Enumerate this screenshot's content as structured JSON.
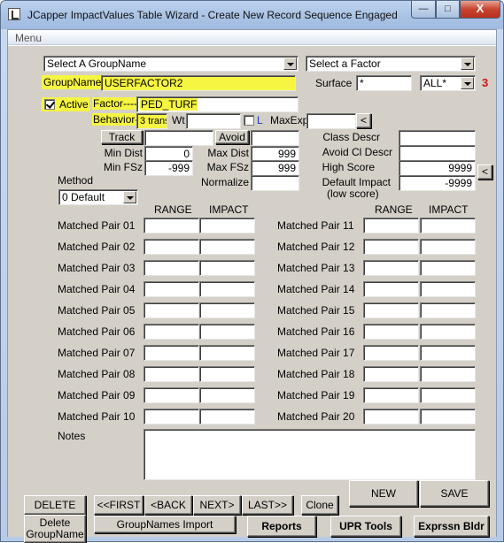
{
  "window": {
    "title": "JCapper ImpactValues Table Wizard -  Create New Record Sequence Engaged",
    "min_label": "—",
    "max_label": "□",
    "close_label": "X"
  },
  "menu": {
    "label": "Menu"
  },
  "group_select": {
    "value": "Select A GroupName"
  },
  "factor_select": {
    "value": "Select a Factor"
  },
  "groupname": {
    "label": "GroupName",
    "value": "USERFACTOR2"
  },
  "surface": {
    "label": "Surface",
    "value": "*",
    "all_value": "ALL*",
    "count": "3"
  },
  "active": {
    "label": "Active",
    "checked": true
  },
  "factor": {
    "label": "Factor-----",
    "value": "PED_TURF"
  },
  "behavior": {
    "label": "Behavior----",
    "value": "3 trans",
    "wt_label": "Wt",
    "wt_value": "",
    "l_label": "L",
    "maxexp_label": "MaxExp",
    "maxexp_value": "",
    "lt_button": "<"
  },
  "track": {
    "button": "Track",
    "value": ""
  },
  "avoid": {
    "button": "Avoid",
    "value": ""
  },
  "min_dist": {
    "label": "Min Dist",
    "value": "0"
  },
  "min_fsz": {
    "label": "Min FSz",
    "value": "-999"
  },
  "max_dist": {
    "label": "Max Dist",
    "value": "999"
  },
  "max_fsz": {
    "label": "Max FSz",
    "value": "999"
  },
  "normalize": {
    "label": "Normalize",
    "value": ""
  },
  "class_descr": {
    "label": "Class Descr",
    "value": ""
  },
  "avoid_cl_descr": {
    "label": "Avoid Cl Descr",
    "value": ""
  },
  "high_score": {
    "label": "High Score",
    "value": "9999"
  },
  "default_impact": {
    "label": "Default Impact",
    "sublabel": "(low score)",
    "value": "-9999",
    "side_button": "<"
  },
  "method": {
    "label": "Method",
    "value": "0 Default"
  },
  "matched_pairs": {
    "range_header": "RANGE",
    "impact_header": "IMPACT",
    "left": [
      "Matched Pair 01",
      "Matched Pair 02",
      "Matched Pair 03",
      "Matched Pair 04",
      "Matched Pair 05",
      "Matched Pair 06",
      "Matched Pair 07",
      "Matched Pair 08",
      "Matched Pair 09",
      "Matched Pair 10"
    ],
    "right": [
      "Matched Pair 11",
      "Matched Pair 12",
      "Matched Pair 13",
      "Matched Pair 14",
      "Matched Pair 15",
      "Matched Pair 16",
      "Matched Pair 17",
      "Matched Pair 18",
      "Matched Pair 19",
      "Matched Pair 20"
    ]
  },
  "notes": {
    "label": "Notes",
    "value": ""
  },
  "buttons": {
    "delete": "DELETE",
    "first": "<<FIRST",
    "back": "<BACK",
    "next": "NEXT>",
    "last": "LAST>>",
    "clone": "Clone",
    "new": "NEW",
    "save": "SAVE",
    "delete_groupname": "Delete\nGroupName",
    "groupnames_import": "GroupNames Import",
    "reports": "Reports",
    "upr_tools": "UPR Tools",
    "exprssn_bldr": "Exprssn Bldr"
  }
}
